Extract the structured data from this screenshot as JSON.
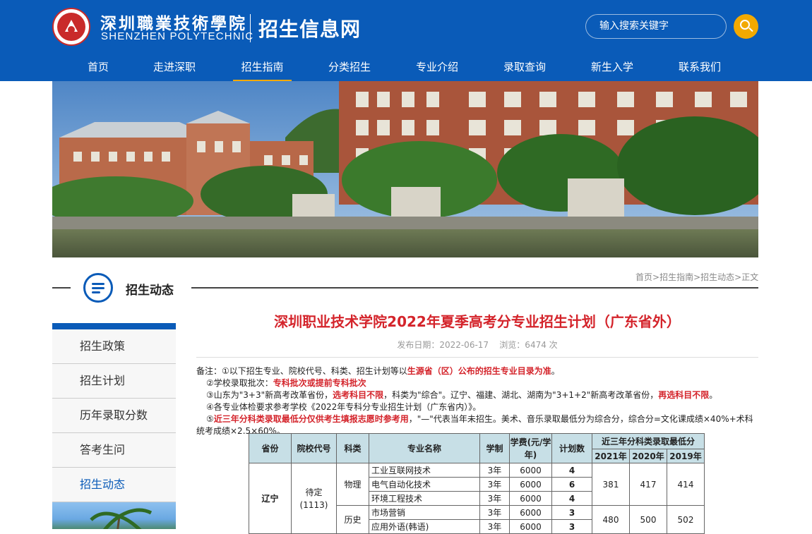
{
  "header": {
    "school_cn": "深圳職業技術學院",
    "school_en": "SHENZHEN  POLYTECHNIC",
    "site_name": "招生信息网",
    "search_placeholder": "输入搜索关键字",
    "search_icon": "search-icon",
    "brand_color": "#0a5bb8",
    "accent_color": "#f2a900"
  },
  "nav": {
    "items": [
      "首页",
      "走进深职",
      "招生指南",
      "分类招生",
      "专业介绍",
      "录取查询",
      "新生入学",
      "联系我们"
    ],
    "active": "招生指南"
  },
  "section": {
    "title": "招生动态",
    "icon": "menu-list-icon",
    "breadcrumb": [
      "首页",
      "招生指南",
      "招生动态",
      "正文"
    ],
    "breadcrumb_sep": ">"
  },
  "sidebar": {
    "items": [
      "招生政策",
      "招生计划",
      "历年录取分数",
      "答考生问",
      "招生动态"
    ],
    "active": "招生动态"
  },
  "article": {
    "title": "深圳职业技术学院2022年夏季高考分专业招生计划（广东省外）",
    "meta": "发布日期：2022-06-17    浏览：6474 次",
    "notes": {
      "n1_a": "备注：①以下招生专业、院校代号、科类、招生计划等以",
      "n1_b": "生源省（区）公布的招生专业目录为准",
      "n1_c": "。",
      "n2_a": "②学校录取批次：",
      "n2_b": "专科批次或提前专科批次",
      "n3_a": "③山东为\"3+3\"新高考改革省份，",
      "n3_b": "选考科目不限",
      "n3_c": "，科类为\"综合\"。辽宁、福建、湖北、湖南为\"3+1+2\"新高考改革省份，",
      "n3_d": "再选科目不限",
      "n3_e": "。",
      "n4": "④各专业体检要求参考学校《2022年专科分专业招生计划（广东省内）》。",
      "n5_a": "⑤",
      "n5_b": "近三年分科类录取最低分仅供考生填报志愿时参考用",
      "n5_c": "，\"—\"代表当年未招生。美术、音乐录取最低分为综合分，综合分=文化课成绩×40%+术科统考成绩×2.5×60%。"
    }
  },
  "table": {
    "headers": {
      "province": "省份",
      "code": "院校代号",
      "category": "科类",
      "major": "专业名称",
      "duration": "学制",
      "fee": "学费(元/学年)",
      "plan": "计划数",
      "recent": "近三年分科类录取最低分",
      "y2021": "2021年",
      "y2020": "2020年",
      "y2019": "2019年"
    },
    "province": "辽宁",
    "code": "待定\n(1113)",
    "groups": [
      {
        "category": "物理",
        "scores": [
          "381",
          "417",
          "414"
        ],
        "rows": [
          {
            "major": "工业互联网技术",
            "duration": "3年",
            "fee": "6000",
            "plan": "4"
          },
          {
            "major": "电气自动化技术",
            "duration": "3年",
            "fee": "6000",
            "plan": "6"
          },
          {
            "major": "环境工程技术",
            "duration": "3年",
            "fee": "6000",
            "plan": "4"
          }
        ]
      },
      {
        "category": "历史",
        "scores": [
          "480",
          "500",
          "502"
        ],
        "rows": [
          {
            "major": "市场营销",
            "duration": "3年",
            "fee": "6000",
            "plan": "3"
          },
          {
            "major": "应用外语(韩语)",
            "duration": "3年",
            "fee": "6000",
            "plan": "3"
          }
        ]
      }
    ]
  }
}
